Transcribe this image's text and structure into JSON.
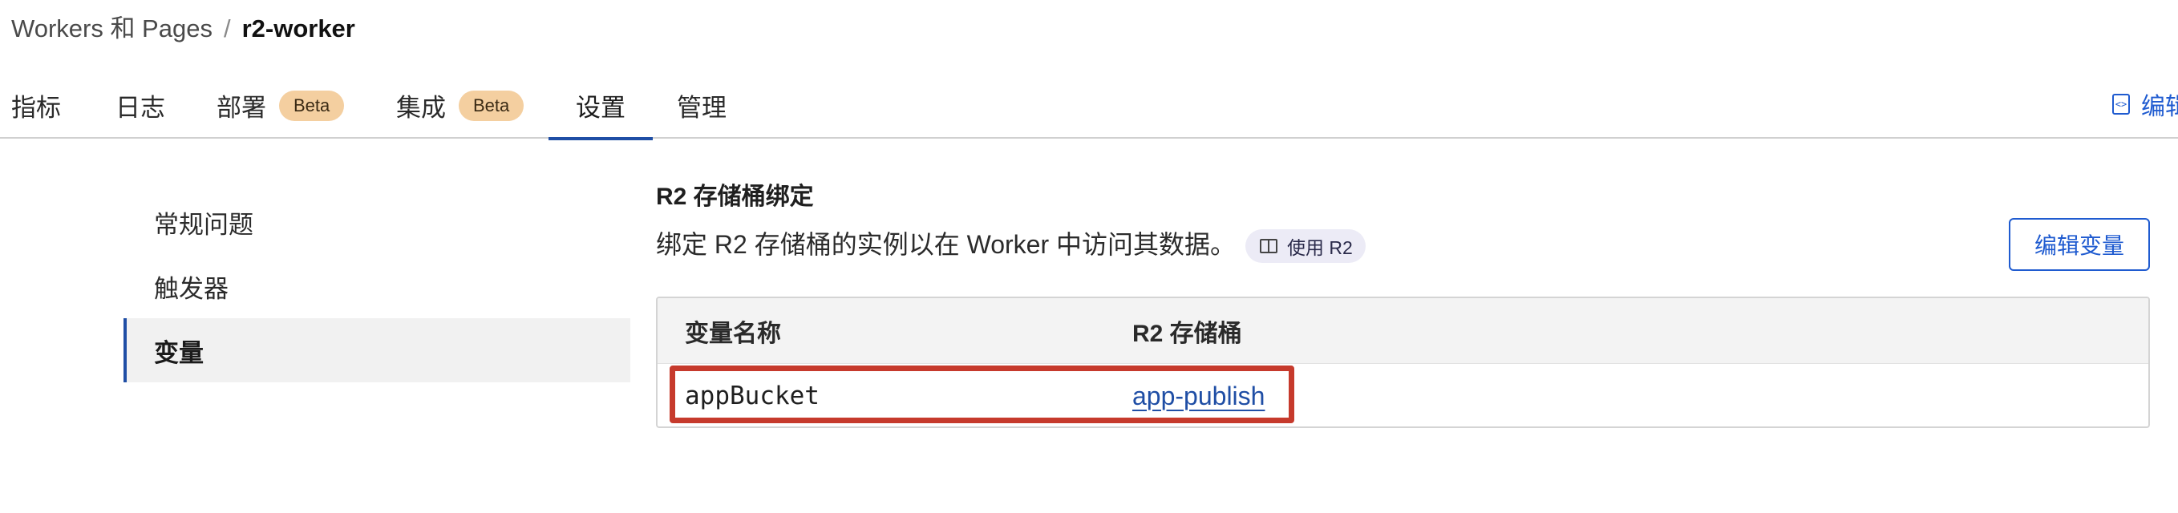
{
  "breadcrumb": {
    "root": "Workers 和 Pages",
    "separator": "/",
    "current": "r2-worker"
  },
  "tabs": [
    {
      "label": "指标"
    },
    {
      "label": "日志"
    },
    {
      "label": "部署",
      "badge": "Beta"
    },
    {
      "label": "集成",
      "badge": "Beta"
    },
    {
      "label": "设置",
      "active": true
    },
    {
      "label": "管理"
    }
  ],
  "header_actions": {
    "edit_code_label": "编辑",
    "edit_code_icon": "code-file-icon"
  },
  "sidebar": {
    "items": [
      {
        "label": "常规问题"
      },
      {
        "label": "触发器"
      },
      {
        "label": "变量",
        "active": true
      }
    ]
  },
  "section": {
    "title": "R2 存储桶绑定",
    "description": "绑定 R2 存储桶的实例以在 Worker 中访问其数据。",
    "doc_link_label": "使用 R2",
    "doc_link_icon": "book-icon",
    "edit_button_label": "编辑变量"
  },
  "table": {
    "columns": [
      "变量名称",
      "R2 存储桶"
    ],
    "rows": [
      {
        "variable": "appBucket",
        "bucket": "app-publish"
      }
    ]
  },
  "colors": {
    "accent": "#1f4ea5",
    "link": "#1f5bd0",
    "badge_bg": "#f4cfa0",
    "highlight": "#c63a2c"
  }
}
